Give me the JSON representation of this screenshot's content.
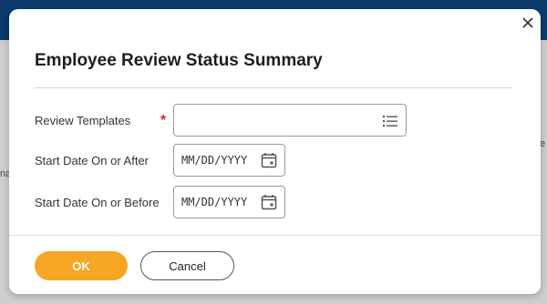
{
  "dialog": {
    "title": "Employee Review Status Summary",
    "fields": {
      "review_templates": {
        "label": "Review Templates",
        "required_mark": "*",
        "value": ""
      },
      "start_after": {
        "label": "Start Date On or After",
        "placeholder": "MM/DD/YYYY"
      },
      "start_before": {
        "label": "Start Date On or Before",
        "placeholder": "MM/DD/YYYY"
      }
    },
    "buttons": {
      "ok": "OK",
      "cancel": "Cancel"
    }
  },
  "background": {
    "left_text": "na",
    "right_text": "e"
  },
  "colors": {
    "ok_button": "#f5a623",
    "required_mark": "#d9262c",
    "top_bar": "#0b3b6b"
  },
  "icons": [
    "close-icon",
    "list-icon",
    "calendar-icon"
  ]
}
